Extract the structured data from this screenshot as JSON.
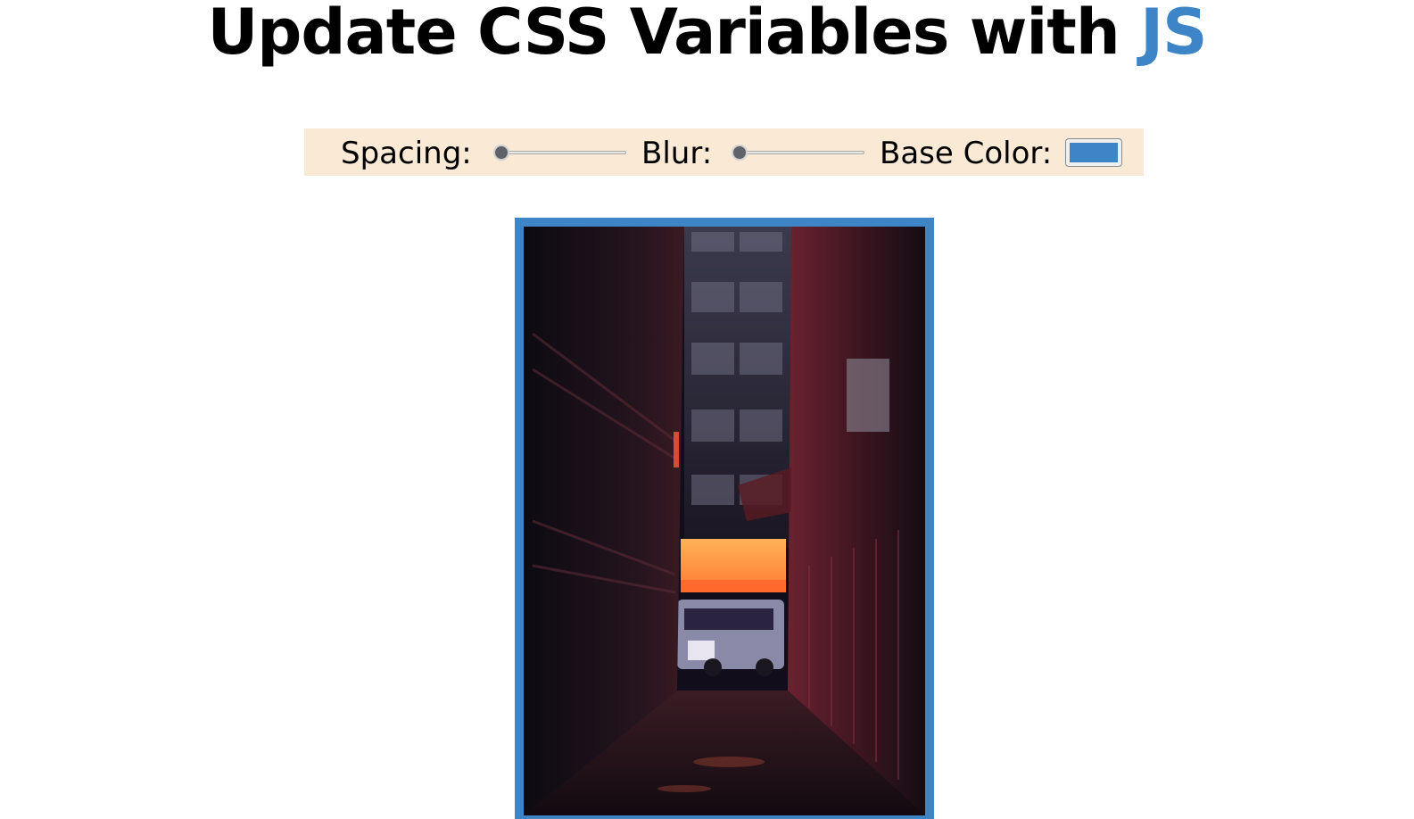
{
  "title": {
    "prefix": "Update CSS Variables with ",
    "highlight": "JS"
  },
  "controls": {
    "spacing_label": "Spacing:",
    "spacing_value": 0,
    "blur_label": "Blur:",
    "blur_value": 0,
    "base_color_label": "Base Color:",
    "base_color_value": "#3d85c6"
  },
  "colors": {
    "accent": "#3d85c6",
    "controls_background": "#f9e9d5"
  },
  "photo": {
    "subject": "night alley with neon-lit bus"
  }
}
